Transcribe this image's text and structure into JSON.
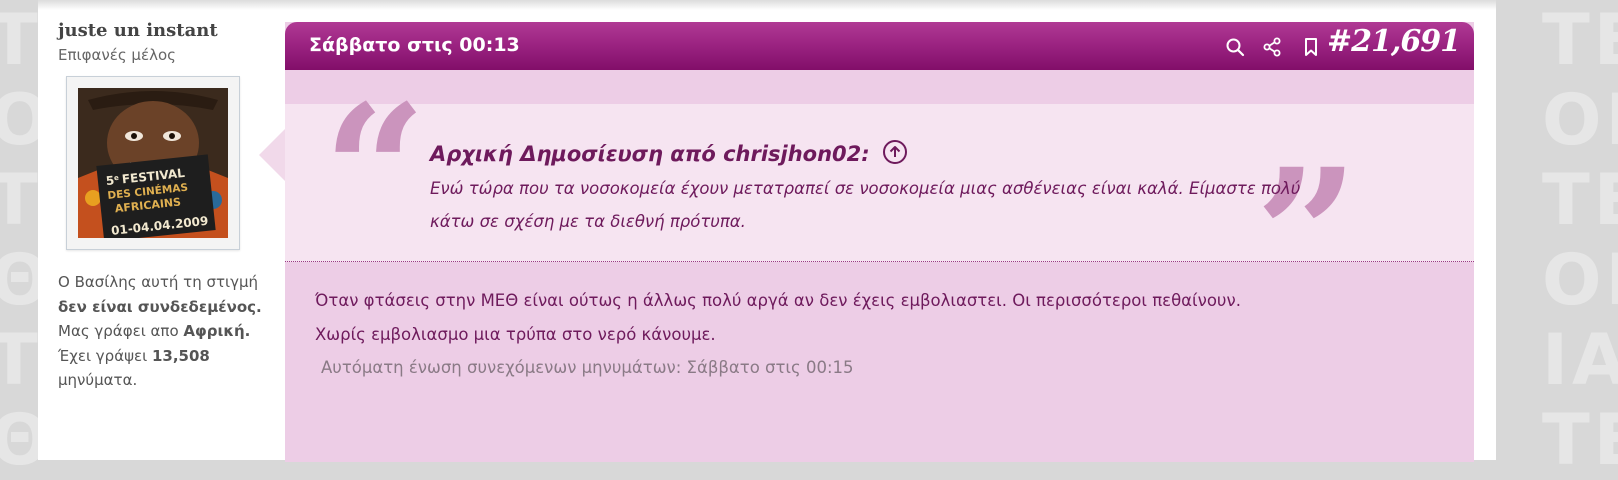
{
  "user": {
    "name": "juste un instant",
    "title": "Επιφανές μέλος",
    "status_line1": "Ο Βασίλης αυτή τη στιγμή",
    "status_offline": "δεν είναι συνδεδεμένος.",
    "location_prefix": "Μας γράφει απο",
    "location": "Αφρική.",
    "posts_prefix": "Έχει γράψει",
    "posts_count": "13,508",
    "posts_suffix": "μηνύματα."
  },
  "avatar_poster": {
    "line1": "5",
    "line1_sup": "e",
    "line1_rest": "FESTIVAL",
    "line2": "DES CINÉMAS",
    "line3": "AFRICAINS",
    "dates": "01-04.04.2009"
  },
  "post": {
    "date": "Σάββατο στις 00:13",
    "number": "#21,691",
    "quote_source": "Αρχική Δημοσίευση από chrisjhon02:",
    "quote_text": "Ενώ τώρα που τα νοσοκομεία έχουν μετατραπεί σε νοσοκομεία μιας ασθένειας είναι καλά. Είμαστε πολύ κάτω σε σχέση με τα διεθνή πρότυπα.",
    "message_line1": "Όταν φτάσεις στην ΜΕΘ είναι ούτως η άλλως πολύ αργά αν δεν έχεις εμβολιαστει. Οι περισσότεροι πεθαίνουν.",
    "message_line2": "Χωρίς εμβολιασμο μια τρύπα στο νερό κάνουμε.",
    "merge_notice": "Αυτόματη ένωση συνεχόμενων μηνυμάτων: Σάββατο στις 00:15"
  },
  "icons": {
    "header": [
      "search-icon",
      "share-icon",
      "bookmark-icon"
    ],
    "quote_link": "arrow-up-circle-icon"
  },
  "colors": {
    "header_top": "#b03a94",
    "header_bottom": "#820e69",
    "post_bg": "#edcde6",
    "quote_bg": "#f6e4f1",
    "text": "#6e1a5c",
    "quote_marks": "#cb94bd"
  }
}
